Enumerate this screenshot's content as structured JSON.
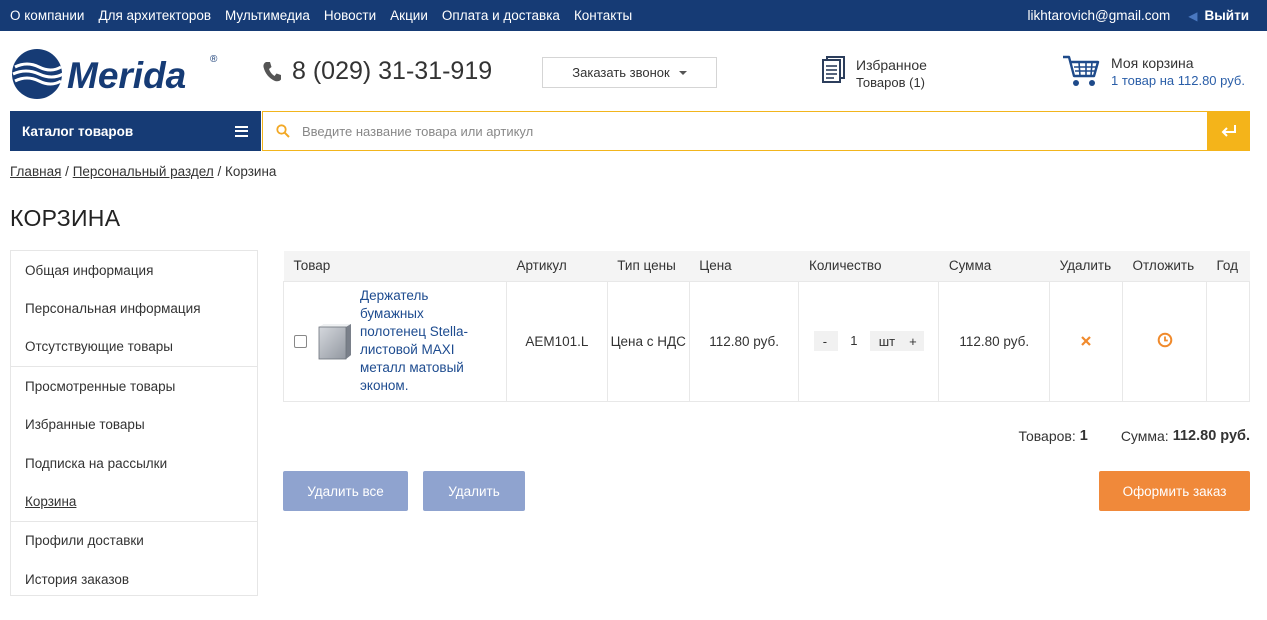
{
  "topnav": {
    "links": [
      "О компании",
      "Для архитекторов",
      "Мультимедиа",
      "Новости",
      "Акции",
      "Оплата и доставка",
      "Контакты"
    ],
    "email": "likhtarovich@gmail.com",
    "exit": "Выйти"
  },
  "header": {
    "logo_text": "Merida",
    "phone": "8 (029) 31-31-919",
    "call_button": "Заказать звонок",
    "favorites_title": "Избранное",
    "favorites_count": "Товаров (1)",
    "cart_title": "Моя корзина",
    "cart_summary": "1 товар на 112.80 руб."
  },
  "catalog": {
    "label": "Каталог товаров"
  },
  "search": {
    "placeholder": "Введите название товара или артикул"
  },
  "breadcrumb": {
    "home": "Главная",
    "personal": "Персональный раздел",
    "current": "Корзина",
    "sep": "/"
  },
  "page": {
    "title": "КОРЗИНА"
  },
  "sidebar": {
    "groups": [
      [
        "Общая информация",
        "Персональная информация",
        "Отсутствующие товары"
      ],
      [
        "Просмотренные товары",
        "Избранные товары",
        "Подписка на рассылки",
        "Корзина"
      ],
      [
        "Профили доставки",
        "История заказов"
      ]
    ]
  },
  "table": {
    "headers": [
      "Товар",
      "Артикул",
      "Тип цены",
      "Цена",
      "Количество",
      "Сумма",
      "Удалить",
      "Отложить",
      "Год"
    ],
    "rows": [
      {
        "name": "Держатель бумажных полотенец Stella-листовой MAXI металл матовый эконом.",
        "article": "AEM101.L",
        "price_type": "Цена с НДС",
        "price": "112.80 руб.",
        "qty_minus": "-",
        "qty": "1",
        "unit": "шт",
        "qty_plus": "+",
        "sum": "112.80 руб."
      }
    ]
  },
  "totals": {
    "items_label": "Товаров:",
    "items": "1",
    "sum_label": "Сумма:",
    "sum": "112.80 руб."
  },
  "buttons": {
    "delete_all": "Удалить все",
    "delete": "Удалить",
    "checkout": "Оформить заказ"
  },
  "colors": {
    "brand_blue": "#163b75",
    "accent_yellow": "#f4b41a",
    "accent_orange": "#f0893a",
    "muted_button": "#8fa3cf"
  }
}
